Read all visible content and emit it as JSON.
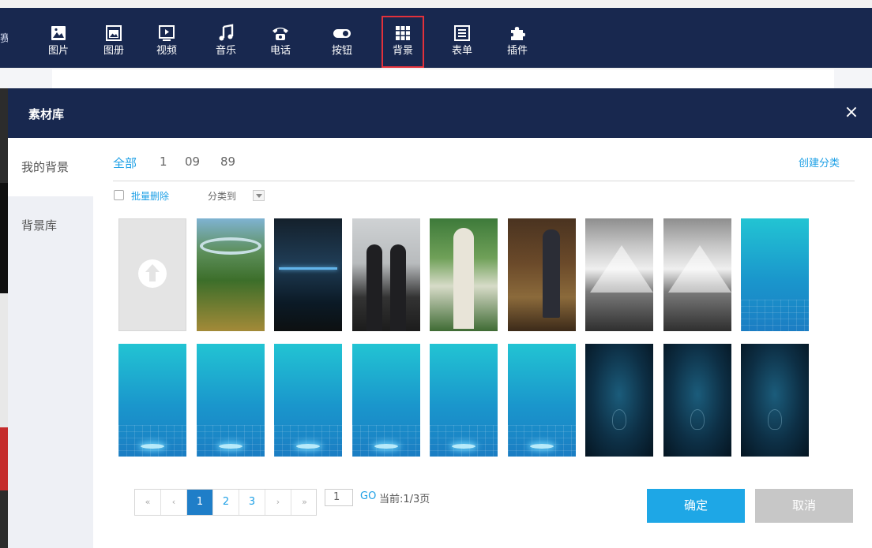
{
  "toolbar": {
    "edge_label": "赛",
    "items": [
      {
        "label": "图片",
        "icon": "image-icon"
      },
      {
        "label": "图册",
        "icon": "album-icon"
      },
      {
        "label": "视频",
        "icon": "video-icon"
      },
      {
        "label": "音乐",
        "icon": "music-icon"
      },
      {
        "label": "电话",
        "icon": "phone-icon"
      },
      {
        "label": "按钮",
        "icon": "toggle-button-icon"
      },
      {
        "label": "背景",
        "icon": "grid-background-icon",
        "active": true
      },
      {
        "label": "表单",
        "icon": "form-icon"
      },
      {
        "label": "插件",
        "icon": "puzzle-plugin-icon"
      }
    ]
  },
  "modal": {
    "title": "素材库",
    "close_label": "×",
    "sidebar": [
      {
        "label": "我的背景",
        "active": true
      },
      {
        "label": "背景库",
        "active": false
      }
    ],
    "filters": [
      {
        "label": "全部",
        "active": true
      },
      {
        "label": "1",
        "active": false
      },
      {
        "label": "09",
        "active": false
      },
      {
        "label": "89",
        "active": false
      }
    ],
    "create_category": "创建分类",
    "bulk_delete": "批量删除",
    "move_to": "分类到",
    "thumbnails": [
      {
        "kind": "upload",
        "icon": "upload-arrow-icon"
      },
      {
        "kind": "photo-a"
      },
      {
        "kind": "photo-b"
      },
      {
        "kind": "photo-c"
      },
      {
        "kind": "photo-d"
      },
      {
        "kind": "photo-e"
      },
      {
        "kind": "mount"
      },
      {
        "kind": "mount"
      },
      {
        "kind": "blue"
      },
      {
        "kind": "blue"
      },
      {
        "kind": "blue"
      },
      {
        "kind": "blue"
      },
      {
        "kind": "blue"
      },
      {
        "kind": "blue"
      },
      {
        "kind": "blue"
      },
      {
        "kind": "dark"
      },
      {
        "kind": "dark"
      },
      {
        "kind": "dark"
      }
    ],
    "pagination": {
      "first": "«",
      "prev": "‹",
      "pages": [
        "1",
        "2",
        "3"
      ],
      "current": "1",
      "next": "›",
      "last": "»",
      "goto_value": "1",
      "go_label": "GO",
      "info": "当前:1/3页"
    },
    "ok_label": "确定",
    "cancel_label": "取消"
  },
  "colors": {
    "nav_bg": "#18284f",
    "accent": "#1ea0e6",
    "active_outline": "#e2313b",
    "page_active": "#1f7ec8",
    "cancel_bg": "#c7c7c7"
  }
}
